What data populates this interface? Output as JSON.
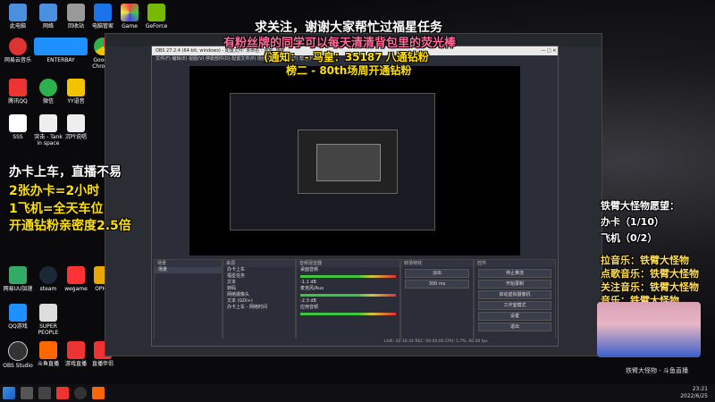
{
  "overlay": {
    "top_line1": "求关注，谢谢大家帮忙过福星任务",
    "top_line2": "有粉丝牌的同学可以每天清清背包里的荧光棒",
    "top_line3": "(通知：    - 马皇：35187 八通钻粉",
    "top_line4": "榜二 - 80th场周开通钻粉",
    "left_line1": "办卡上车，直播不易",
    "left_line2": "2张办卡=2小时",
    "left_line3": "1飞机=全天车位",
    "left_line4": "开通钻粉亲密度2.5倍",
    "right_title": "铁臂大怪物愿望：",
    "right_item1": "办卡（1/10）",
    "right_item2": "飞机（0/2）",
    "music": [
      "拉音乐：铁臂大怪物",
      "点歌音乐：铁臂大怪物",
      "关注音乐：铁臂大怪物",
      "音乐：铁臂大怪物"
    ]
  },
  "desktop_icons": [
    {
      "label": "此电脑",
      "color": "#4a8fe0"
    },
    {
      "label": "网络",
      "color": "#4a8fe0"
    },
    {
      "label": "回收站",
      "color": "#999"
    },
    {
      "label": "电脑管家",
      "color": "#1a73e8"
    },
    {
      "label": "Game",
      "color": "#e44"
    },
    {
      "label": "GeForce",
      "color": "#76b900"
    },
    {
      "label": "网易云音乐",
      "color": "#d33"
    },
    {
      "label": "ENTERBAY",
      "color": "#1e90ff"
    },
    {
      "label": "腾讯QQ",
      "color": "#e33"
    },
    {
      "label": "微信",
      "color": "#2bb24c"
    },
    {
      "label": "YY语音",
      "color": "#f3c300"
    },
    {
      "label": "Google Chrome",
      "color": "#e44"
    },
    {
      "label": "SSS",
      "color": "#fff"
    },
    {
      "label": "突击 - Tank in space",
      "color": "#fff"
    },
    {
      "label": "沉吟说唱",
      "color": "#fff"
    },
    {
      "label": "网易UU加速",
      "color": "#3a6"
    },
    {
      "label": "steam",
      "color": "#1b2838"
    },
    {
      "label": "wegame",
      "color": "#f33"
    },
    {
      "label": "OPHO",
      "color": "#e6a800"
    },
    {
      "label": "QQ游戏",
      "color": "#1e90ff"
    },
    {
      "label": "SUPER PEOPLE",
      "color": "#ddd"
    },
    {
      "label": "OBS Studio",
      "color": "#333"
    },
    {
      "label": "斗鱼直播",
      "color": "#f60"
    },
    {
      "label": "游戏直播",
      "color": "#e33"
    },
    {
      "label": "直播伴侣",
      "color": "#e33"
    }
  ],
  "obs": {
    "title": "OBS 27.2.4 (64-bit, windows) - 配置文件: 未命名 - 场景: 场景",
    "menu": "文件(F)  编辑(E)  视图(V)  停靠部件(D)  配置文件(P)  场景集合(S)  工具(T)  帮助(H)",
    "docks": {
      "scenes_title": "场景",
      "scenes": [
        "场景"
      ],
      "sources_title": "来源",
      "sources": [
        "办卡上车",
        "福星任务",
        "文本",
        "转码",
        "网络摄像头",
        "文本 (GDI+)",
        "办卡上车 - 网络时间"
      ],
      "mixer_title": "音频混音器",
      "mixer": [
        {
          "name": "桌面音频",
          "db": "-1.1 dB"
        },
        {
          "name": "麦克风/Aux",
          "db": "-2.3 dB"
        },
        {
          "name": "应用音频",
          "db": "0.0 dB"
        }
      ],
      "transitions_title": "转场特效",
      "transition": "淡出",
      "duration": "300 ms",
      "controls_title": "控件",
      "controls": [
        "停止推流",
        "开始录制",
        "启动虚拟摄像机",
        "工作室模式",
        "设置",
        "退出"
      ]
    },
    "status": "LIVE: 02:16:34   REC: 00:00:00   CPU: 5.7%, 60.00 fps"
  },
  "taskbar": {
    "clock_time": "23:21",
    "clock_date": "2022/6/25"
  },
  "watermark": "铁臂大怪物 - 斗鱼直播",
  "colors": {
    "yellow": "#ffe000",
    "red": "#ff2a2a",
    "obs_bg": "#2b2e38"
  }
}
